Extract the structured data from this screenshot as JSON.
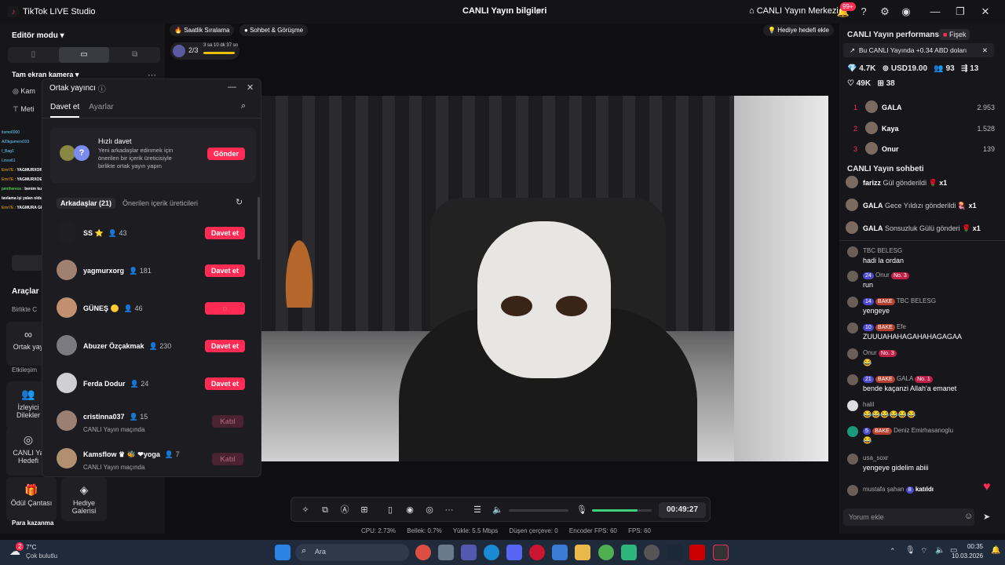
{
  "titlebar": {
    "app_title": "TikTok LIVE Studio",
    "center_title": "CANLI Yayın bilgileri",
    "center_button": "CANLI Yayın Merkezi",
    "notif_badge": "99+"
  },
  "left": {
    "editor_mode": "Editör modu",
    "camera_label": "Tam ekran kamera",
    "source_camera": "Kam",
    "source_text": "Meti",
    "tools_title": "Araçlar",
    "together_label": "Birlikte C",
    "cohost_tool": "Ortak yay",
    "interaction_label": "Etkileşim",
    "viewer_tool_1": "İzleyici",
    "viewer_tool_2": "Dilekler",
    "live_tool_1": "CANLI Ya",
    "live_tool_2": "Hedefi",
    "reward_tool": "Ödül Çantası",
    "gift_gallery_1": "Hediye",
    "gift_gallery_2": "Galerisi",
    "earn_title": "Para kazanma"
  },
  "mini_chat": [
    {
      "user": "itsmo6000"
    },
    {
      "user": "AZIkgamerx033"
    },
    {
      "user": "f_Bag1"
    },
    {
      "user": "Linos61"
    },
    {
      "user": "Emr7E",
      "text": "YAGMURXORG"
    },
    {
      "user": "Emr7E",
      "text": "YAGMURXOEG"
    },
    {
      "user": "penthereos",
      "text": "benim kızı tavlama işi yalan oldu"
    },
    {
      "user": "Emr7E",
      "text": "YAGMURA GELLİM"
    }
  ],
  "pills": {
    "hourly_rank": "Saatlik Sıralama",
    "chat_meet": "Sohbet & Görüşme",
    "gift_goal": "Hediye hedefi ekle",
    "progress": "2/3",
    "timer": "3 sa 10 dk 37 sn"
  },
  "cohost": {
    "title": "Ortak yayıncı",
    "tab_invite": "Davet et",
    "tab_settings": "Ayarlar",
    "quick_title": "Hızlı davet",
    "quick_desc": "Yeni arkadaşlar edinmek için önerilen bir içerik üreticisiyle birlikte ortak yayın yapın",
    "send_button": "Gönder",
    "friends_tab": "Arkadaşlar (21)",
    "suggested_tab": "Önerilen içerik üreticileri",
    "invite_label": "Davet et",
    "joined_label": "Katıl",
    "friends": [
      {
        "name": "SS",
        "count": "43",
        "status": "invite"
      },
      {
        "name": "yagmurxorg",
        "count": "181",
        "status": "invite"
      },
      {
        "name": "GÜNEŞ",
        "count": "46",
        "status": "loading"
      },
      {
        "name": "Abuzer Özçakmak",
        "count": "230",
        "status": "invite"
      },
      {
        "name": "Ferda Dodur",
        "count": "24",
        "status": "invite"
      },
      {
        "name": "cristinna037",
        "count": "15",
        "status": "joined",
        "sub": "CANLI Yayın maçında"
      },
      {
        "name": "Kamsflow",
        "count": "7",
        "status": "joined",
        "sub": "CANLI Yayın maçında",
        "extra": "yoga"
      }
    ]
  },
  "controls": {
    "timer": "00:49:27"
  },
  "stats": {
    "cpu": "CPU: 2.73%",
    "mem": "Bellek: 0.7%",
    "upload": "Yükle: 5.5 Mbps",
    "dropped": "Düşen çerçeve: 0",
    "encoder_fps": "Encoder FPS: 60",
    "fps": "FPS: 60"
  },
  "right": {
    "perf_title": "CANLI Yayın performansı",
    "firework": "Fişek",
    "earn_banner": "Bu CANLI Yayında +0.34 ABD doları",
    "metrics": {
      "diamonds": "4.7K",
      "usd": "USD19.00",
      "viewers": "93",
      "shares": "13",
      "likes": "49K",
      "gifts": "38"
    },
    "ranking": [
      {
        "rank": "1",
        "name": "GALA",
        "score": "2.953"
      },
      {
        "rank": "2",
        "name": "Kaya",
        "score": "1.528"
      },
      {
        "rank": "3",
        "name": "Onur",
        "score": "139"
      }
    ],
    "chat_title": "CANLI Yayın sohbeti",
    "gift_events": [
      {
        "user": "farizz",
        "action": "Gül gönderildi",
        "mult": "x1"
      },
      {
        "user": "GALA",
        "action": "Gece Yıldızı gönderildi",
        "mult": "x1"
      },
      {
        "user": "GALA",
        "action": "Sonsuzluk Gülü gönderi",
        "mult": "x1"
      }
    ],
    "chat": [
      {
        "meta": "TBC BELESG",
        "msg": "hadi la ordan"
      },
      {
        "lvl": "24",
        "user": "Onur",
        "no": "No. 3",
        "msg": "run"
      },
      {
        "lvl": "14",
        "bake": "BAKE",
        "user": "TBC BELESG",
        "msg": "yengeye"
      },
      {
        "lvl": "10",
        "bake": "BAKE",
        "user": "Efe",
        "msg": "ZUUUAHAHAGAHAHAGAGAA"
      },
      {
        "user": "Onur",
        "no": "No. 3",
        "msg": "😂"
      },
      {
        "lvl": "21",
        "bake": "BAKE",
        "user": "GALA",
        "no": "No. 1",
        "msg": "bende kaçanzi Allah'a emanet"
      },
      {
        "user": "halil",
        "msg": "😂😂😂😂😂😂"
      },
      {
        "lvl": "5",
        "bake": "BAKE",
        "user": "Deniz Emirhasanoglu",
        "msg": "😂"
      },
      {
        "user": "usa_soxr",
        "msg": "yengeye gidelim abiii"
      },
      {
        "user": "mustafa şahan",
        "lvl": "8",
        "msg": "katıldı"
      }
    ],
    "comment_placeholder": "Yorum ekle"
  },
  "taskbar": {
    "temp": "7°C",
    "weather": "Çok bulutlu",
    "weather_badge": "2",
    "search_placeholder": "Ara",
    "time": "00:35",
    "date": "10.03.2026"
  }
}
